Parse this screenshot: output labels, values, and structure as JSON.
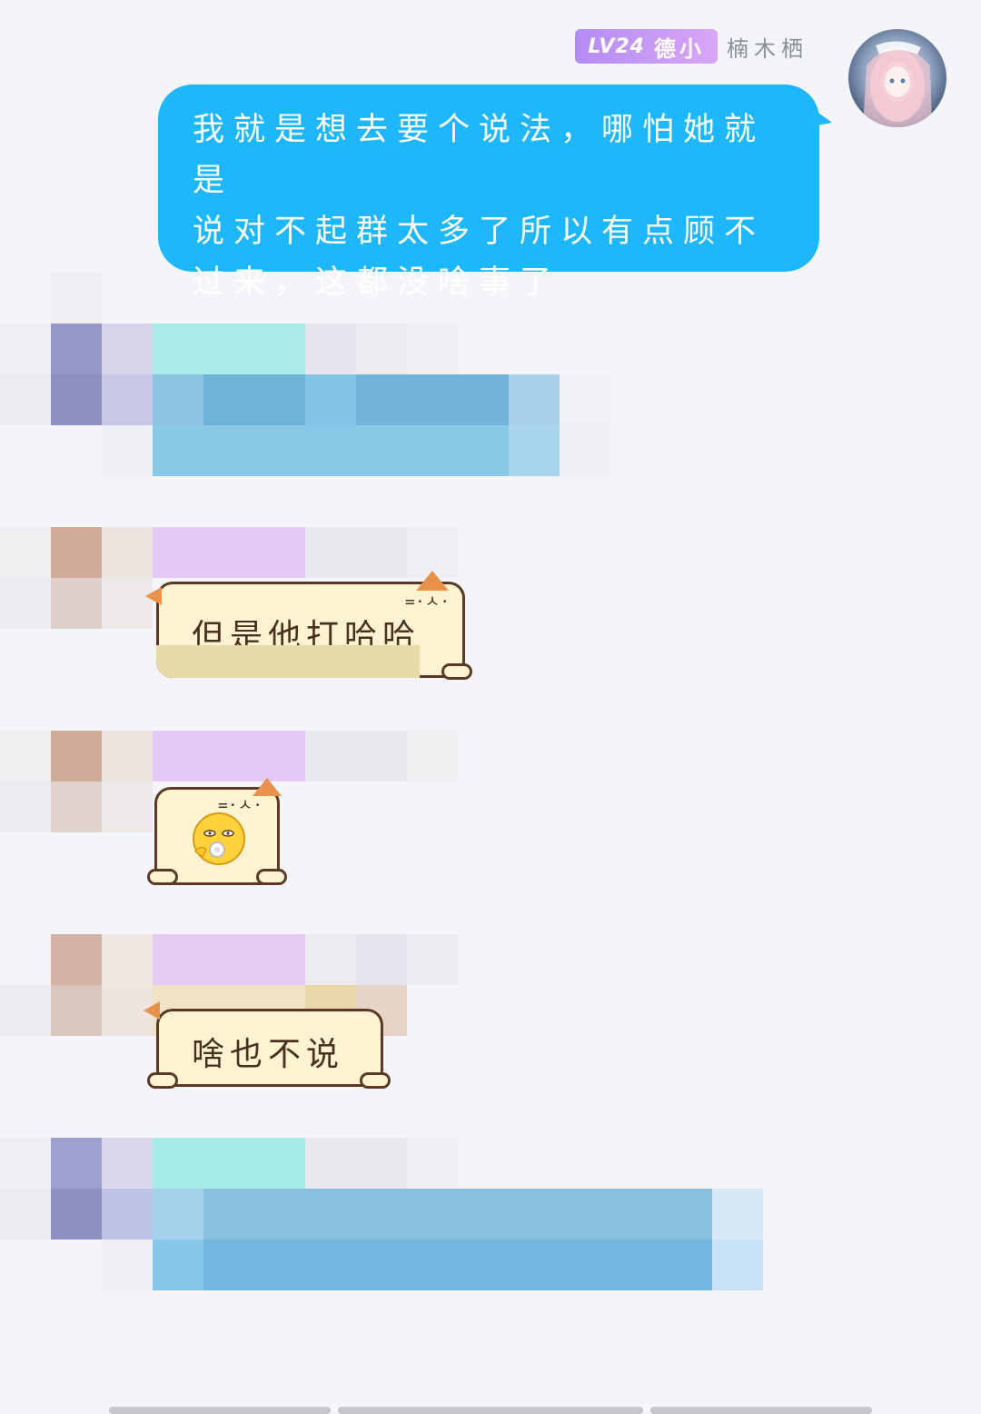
{
  "me": {
    "level_badge": "LV24",
    "title_badge": "德小",
    "name": "楠木栖",
    "message": "我就是想去要个说法，哪怕她就是说对不起群太多了所以有点顾不过来，这都没啥事了",
    "message_lines": [
      "我就是想去要个说法，哪怕她就是",
      "说对不起群太多了所以有点顾不",
      "过来，这都没啥事了"
    ]
  },
  "messages": [
    {
      "text": "但是他打哈哈"
    },
    {
      "emoji": "😯"
    },
    {
      "text": "啥也不说"
    }
  ],
  "colors": {
    "my_bubble": "#1fb7fb",
    "cat_bubble": "#fff3d2",
    "badge_gradient_start": "#b38cf3",
    "badge_gradient_end": "#d9a6f6",
    "background": "#f3f5f9"
  }
}
